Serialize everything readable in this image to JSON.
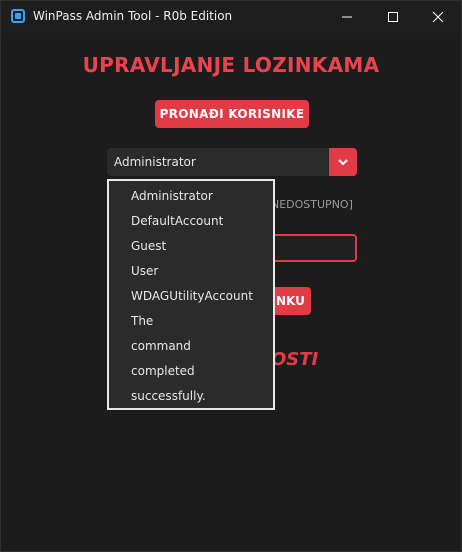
{
  "window": {
    "title": "WinPass Admin Tool - R0b Edition",
    "controls": {
      "minimize": "minimize",
      "maximize": "maximize",
      "close": "close"
    }
  },
  "main": {
    "heading": "UPRAVLJANJE LOZINKAMA",
    "find_users_label": "PRONAĐI KORISNIKE",
    "user_select": {
      "selected": "Administrator"
    },
    "status_fragment": "NEDOSTUPNO]",
    "change_button_fragment": "NKU",
    "large_label_fragment": "OSTI"
  },
  "dropdown": {
    "options": [
      "Administrator",
      "DefaultAccount",
      "Guest",
      "User",
      "WDAGUtilityAccount",
      "The",
      "command",
      "completed",
      "successfully."
    ]
  },
  "colors": {
    "accent": "#e23b48",
    "background": "#1c1c1c",
    "text": "#e6e6e6"
  }
}
